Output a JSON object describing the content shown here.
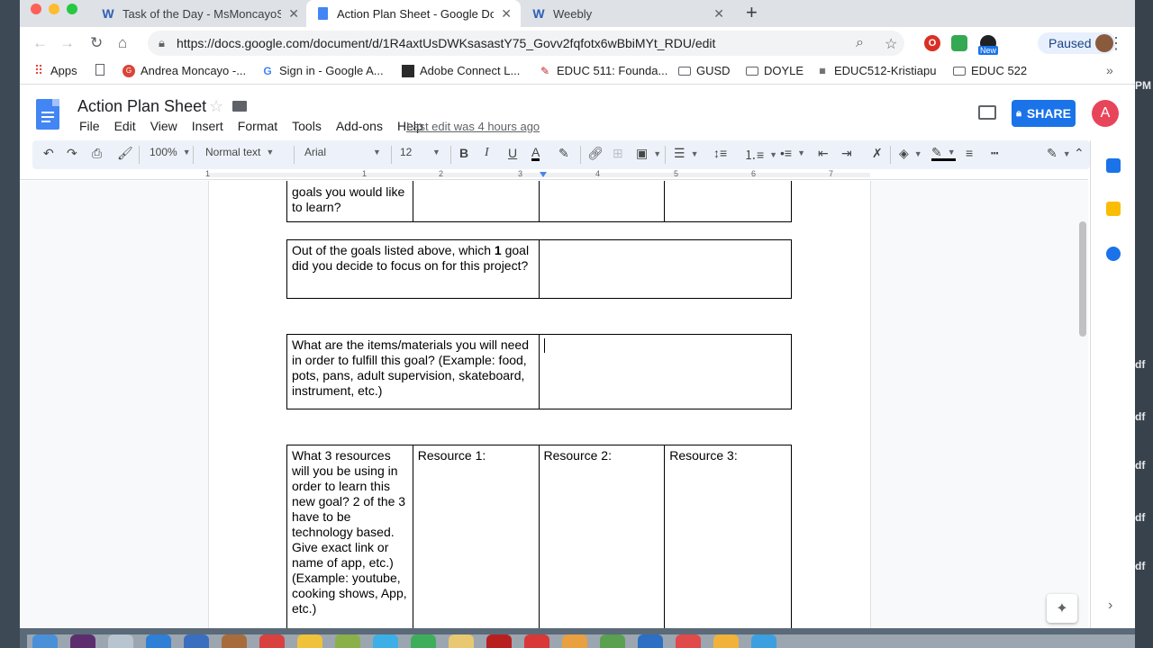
{
  "browser": {
    "tabs": [
      {
        "title": "Task of the Day - MsMoncayoS",
        "favicon": "weebly-icon"
      },
      {
        "title": "Action Plan Sheet - Google Doc",
        "favicon": "docs-icon",
        "active": true
      },
      {
        "title": "Weebly",
        "favicon": "weebly-icon"
      }
    ],
    "url": "https://docs.google.com/document/d/1R4axtUsDWKsasastY75_Govv2fqfotx6wBbiMYt_RDU/edit",
    "profile_status": "Paused",
    "ext_badge": "New",
    "bookmarks": [
      "Apps",
      "Andrea Moncayo -...",
      "Sign in - Google A...",
      "Adobe Connect L...",
      "EDUC 511: Founda...",
      "GUSD",
      "DOYLE",
      "EDUC512-Kristiapu",
      "EDUC 522"
    ],
    "bookmarks_more": "»"
  },
  "docs": {
    "title": "Action Plan Sheet",
    "menu": [
      "File",
      "Edit",
      "View",
      "Insert",
      "Format",
      "Tools",
      "Add-ons",
      "Help"
    ],
    "last_edit": "Last edit was 4 hours ago",
    "share_label": "SHARE",
    "account_initial": "A",
    "toolbar": {
      "zoom": "100%",
      "style": "Normal text",
      "font": "Arial",
      "size": "12"
    },
    "ruler": [
      "1",
      "1",
      "2",
      "3",
      "4",
      "5",
      "6",
      "7"
    ]
  },
  "document": {
    "table1": {
      "q": "goals you would like to learn?"
    },
    "table2": {
      "q_pre": "Out of the goals listed above, which ",
      "q_bold": "1",
      "q_post": " goal did you decide to focus on for this project?"
    },
    "table3": {
      "q": "What are the items/materials you will need in order to fulfill this goal? (Example: food, pots, pans, adult supervision, skateboard, instrument, etc.)"
    },
    "table4": {
      "q": "What 3 resources will you be using in order to learn this new goal? 2 of the 3 have to be technology based. Give exact link or name of app, etc.)(Example: youtube, cooking shows, App, etc.)",
      "r1": "Resource 1:",
      "r2": "Resource 2:",
      "r3": "Resource 3:"
    }
  },
  "desktop": {
    "clip_labels": [
      "PM",
      "df",
      "df",
      "df",
      "df",
      "df"
    ]
  }
}
